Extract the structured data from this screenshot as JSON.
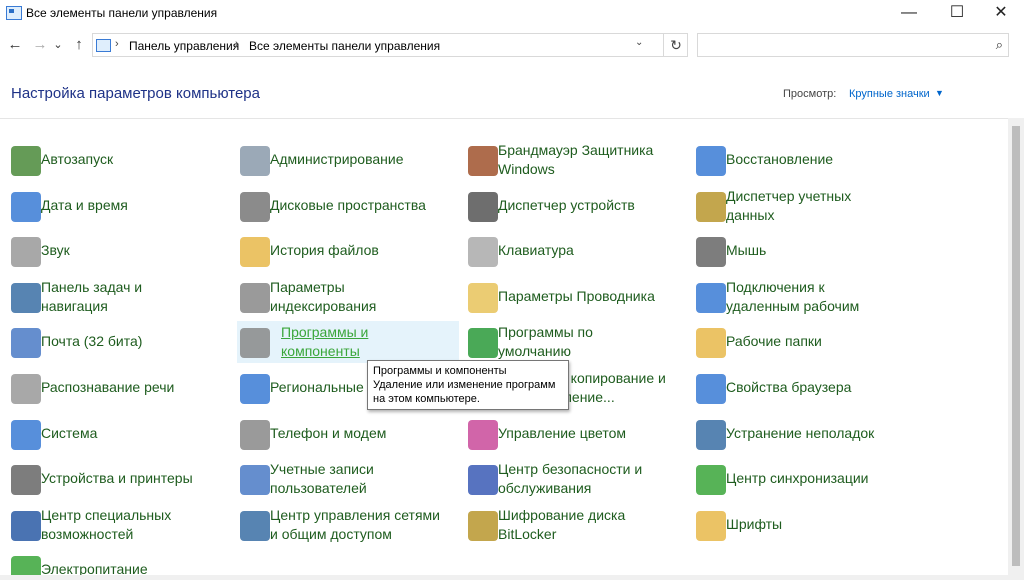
{
  "window": {
    "title": "Все элементы панели управления",
    "minimize": "—",
    "maximize": "☐",
    "close": "✕"
  },
  "nav": {
    "back": "←",
    "forward": "→",
    "recent": "⌄",
    "up": "↑",
    "breadcrumb": [
      "Панель управления",
      "Все элементы панели управления"
    ],
    "refresh": "↻",
    "dropdown": "⌄",
    "search_placeholder": "",
    "search_icon": "⌕"
  },
  "header": {
    "title": "Настройка параметров компьютера",
    "view_label": "Просмотр:",
    "view_value": "Крупные значки",
    "view_caret": "▼"
  },
  "items": [
    {
      "label": "Автозапуск",
      "icon": "autoplay-icon",
      "color": "#4a8a3a"
    },
    {
      "label": "Администрирование",
      "icon": "admin-tools-icon",
      "color": "#8a9aaa"
    },
    {
      "label": "Брандмауэр Защитника\nWindows",
      "icon": "firewall-icon",
      "color": "#a0522d"
    },
    {
      "label": "Восстановление",
      "icon": "recovery-icon",
      "color": "#3a7bd5"
    },
    {
      "label": "Дата и время",
      "icon": "clock-icon",
      "color": "#3a7bd5"
    },
    {
      "label": "Дисковые пространства",
      "icon": "storage-spaces-icon",
      "color": "#777777"
    },
    {
      "label": "Диспетчер устройств",
      "icon": "device-manager-icon",
      "color": "#555555"
    },
    {
      "label": "Диспетчер учетных\nданных",
      "icon": "credential-manager-icon",
      "color": "#b8962e"
    },
    {
      "label": "Звук",
      "icon": "sound-icon",
      "color": "#999999"
    },
    {
      "label": "История файлов",
      "icon": "file-history-icon",
      "color": "#e8b84a"
    },
    {
      "label": "Клавиатура",
      "icon": "keyboard-icon",
      "color": "#aaaaaa"
    },
    {
      "label": "Мышь",
      "icon": "mouse-icon",
      "color": "#666666"
    },
    {
      "label": "Панель задач и\nнавигация",
      "icon": "taskbar-icon",
      "color": "#3a6ea5"
    },
    {
      "label": "Параметры\nиндексирования",
      "icon": "indexing-icon",
      "color": "#888888"
    },
    {
      "label": "Параметры Проводника",
      "icon": "explorer-options-icon",
      "color": "#e8c35a"
    },
    {
      "label": "Подключения к\nудаленным рабочим",
      "icon": "remote-desktop-icon",
      "color": "#3a7bd5"
    },
    {
      "label": "Почта (32 бита)",
      "icon": "mail-icon",
      "color": "#4a7ac5"
    },
    {
      "label": "Программы и\nкомпоненты",
      "icon": "programs-icon",
      "color": "#888888"
    },
    {
      "label": "Программы по\nумолчанию",
      "icon": "default-programs-icon",
      "color": "#2a9a3a"
    },
    {
      "label": "Рабочие папки",
      "icon": "work-folders-icon",
      "color": "#e8b84a"
    },
    {
      "label": "Распознавание речи",
      "icon": "microphone-icon",
      "color": "#999999"
    },
    {
      "label": "Региональные стандарты",
      "icon": "region-icon",
      "color": "#3a7bd5"
    },
    {
      "label": "Резервное копирование и\nвосстановление...",
      "icon": "backup-icon",
      "color": "#3a9a3a"
    },
    {
      "label": "Свойства браузера",
      "icon": "internet-options-icon",
      "color": "#3a7bd5"
    },
    {
      "label": "Система",
      "icon": "system-icon",
      "color": "#3a7bd5"
    },
    {
      "label": "Телефон и модем",
      "icon": "phone-modem-icon",
      "color": "#888888"
    },
    {
      "label": "Управление цветом",
      "icon": "color-management-icon",
      "color": "#c94a9a"
    },
    {
      "label": "Устранение неполадок",
      "icon": "troubleshooting-icon",
      "color": "#3a6ea5"
    },
    {
      "label": "Устройства и принтеры",
      "icon": "printer-icon",
      "color": "#666666"
    },
    {
      "label": "Учетные записи\nпользователей",
      "icon": "user-accounts-icon",
      "color": "#4a7ac5"
    },
    {
      "label": "Центр безопасности и\nобслуживания",
      "icon": "flag-icon",
      "color": "#3a5ab5"
    },
    {
      "label": "Центр синхронизации",
      "icon": "sync-icon",
      "color": "#3aa63a"
    },
    {
      "label": "Центр специальных\nвозможностей",
      "icon": "accessibility-icon",
      "color": "#2a5aa5"
    },
    {
      "label": "Центр управления сетями\nи общим доступом",
      "icon": "network-icon",
      "color": "#3a6ea5"
    },
    {
      "label": "Шифрование диска\nBitLocker",
      "icon": "bitlocker-icon",
      "color": "#b8962e"
    },
    {
      "label": "Шрифты",
      "icon": "fonts-icon",
      "color": "#e8b84a"
    },
    {
      "label": "Электропитание",
      "icon": "power-icon",
      "color": "#3aa63a"
    }
  ],
  "tooltip": {
    "title": "Программы и компоненты",
    "text": "Удаление или изменение программ на этом компьютере."
  }
}
